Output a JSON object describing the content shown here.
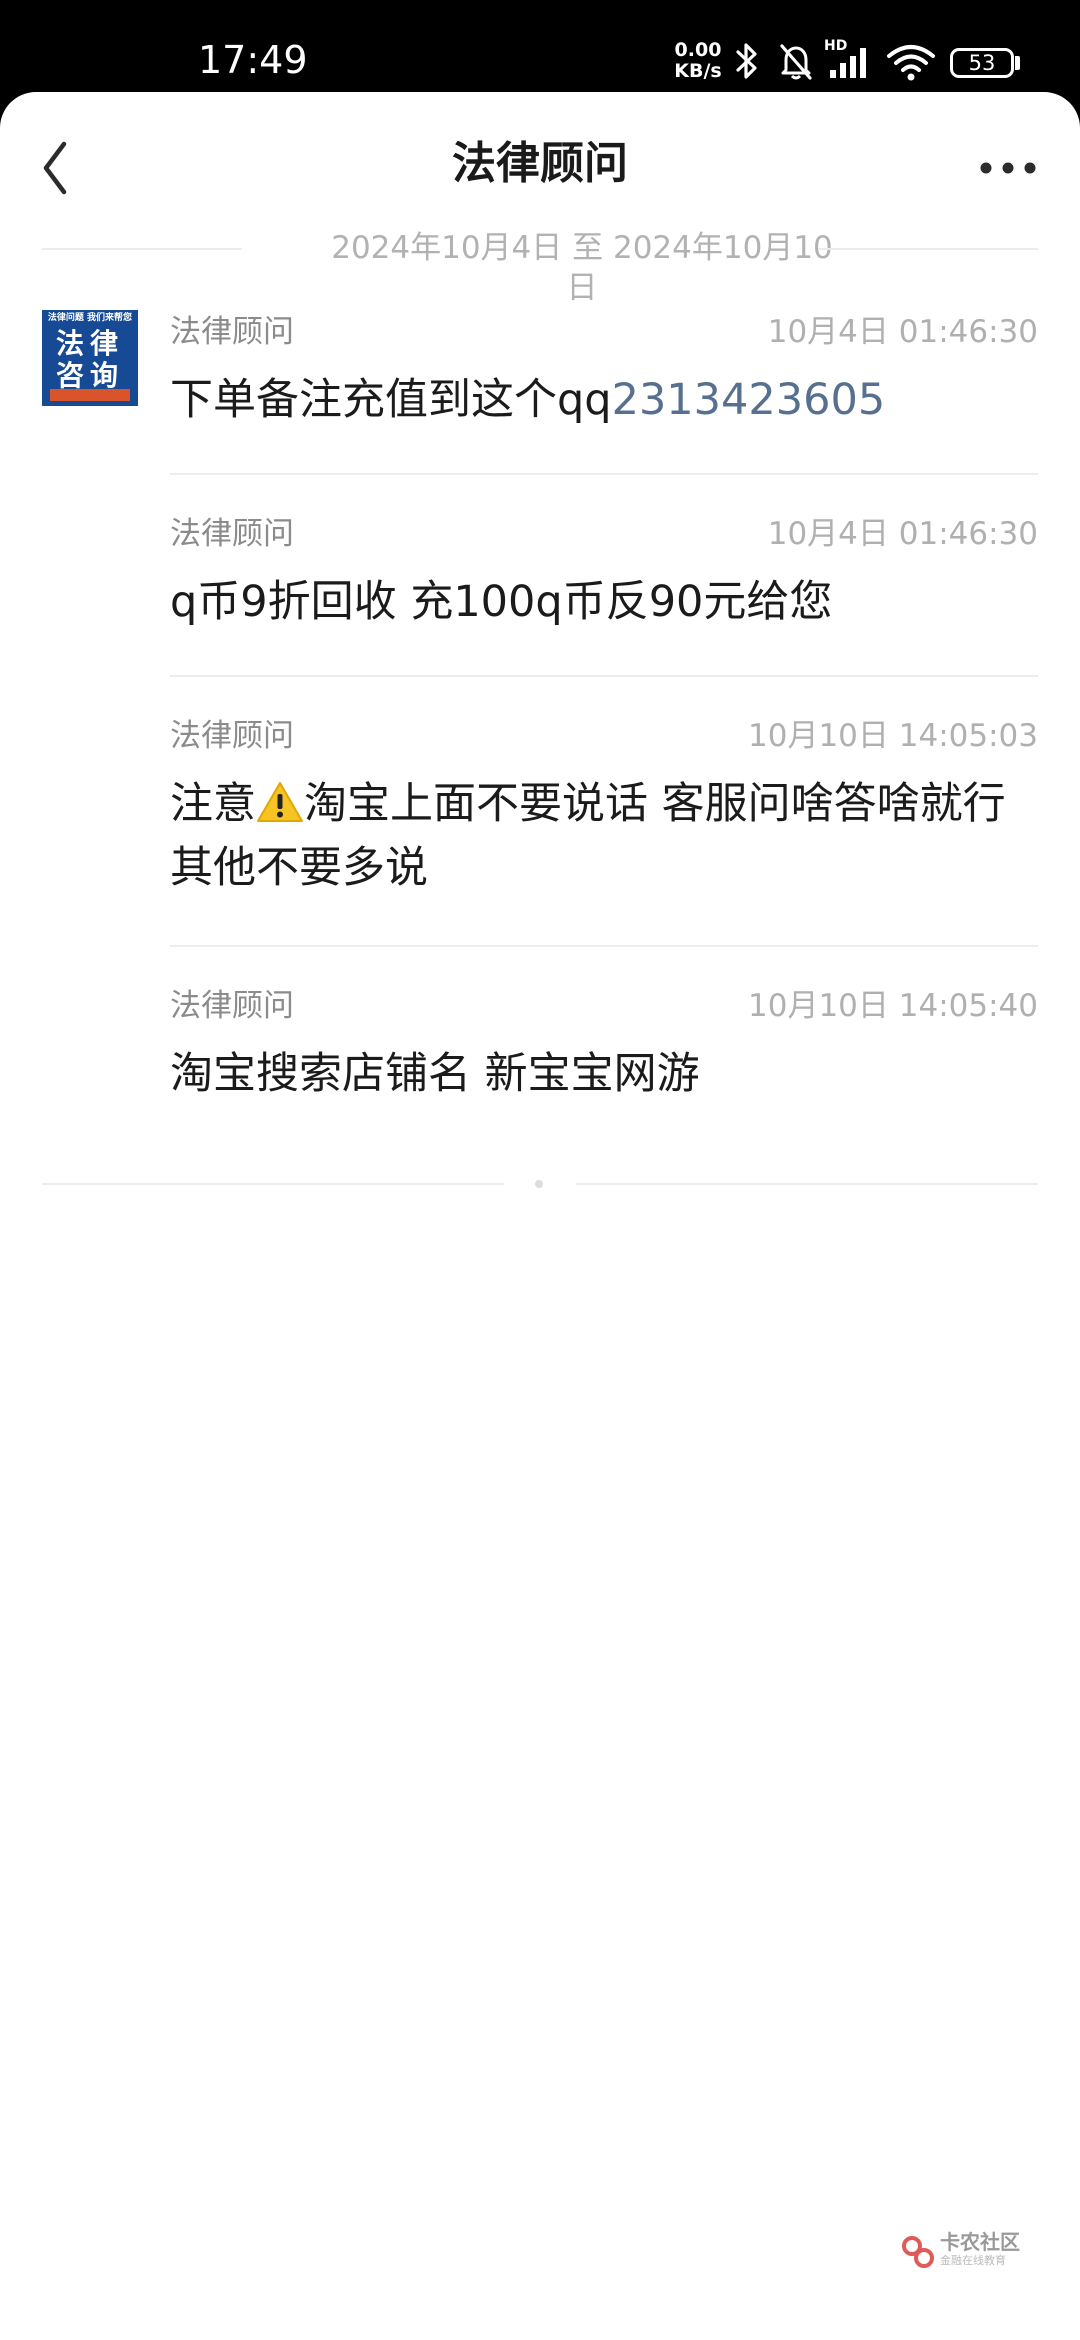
{
  "status_bar": {
    "time": "17:49",
    "net_speed_value": "0.00",
    "net_speed_unit": "KB/s",
    "network_label": "HD",
    "battery": "53"
  },
  "header": {
    "title": "法律顾问",
    "back_icon": "chevron-left-icon",
    "more_icon": "more-horizontal-icon"
  },
  "date_range": "2024年10月4日 至 2024年10月10日",
  "avatar": {
    "top_text": "法律问题 我们来帮您",
    "main_line1": "法律",
    "main_line2": "咨询",
    "colors": {
      "background": "#174a94",
      "footer": "#d9542a"
    }
  },
  "messages": [
    {
      "sender": "法律顾问",
      "time": "10月4日 01:46:30",
      "text": "下单备注充值到这个qq",
      "link": "2313423605"
    },
    {
      "sender": "法律顾问",
      "time": "10月4日 01:46:30",
      "text": "q币9折回收  充100q币反90元给您"
    },
    {
      "sender": "法律顾问",
      "time": "10月10日 14:05:03",
      "text_before_icon": "注意",
      "icon": "warning-icon",
      "text_after_icon": "淘宝上面不要说话 客服问啥答啥就行 其他不要多说"
    },
    {
      "sender": "法律顾问",
      "time": "10月10日 14:05:40",
      "text": "淘宝搜索店铺名  新宝宝网游"
    }
  ],
  "watermark": {
    "text": "卡农社区",
    "subtext": "金融在线教育"
  },
  "colors": {
    "link": "#57708f",
    "meta_text": "#b0b0b0",
    "background": "#ffffff"
  }
}
